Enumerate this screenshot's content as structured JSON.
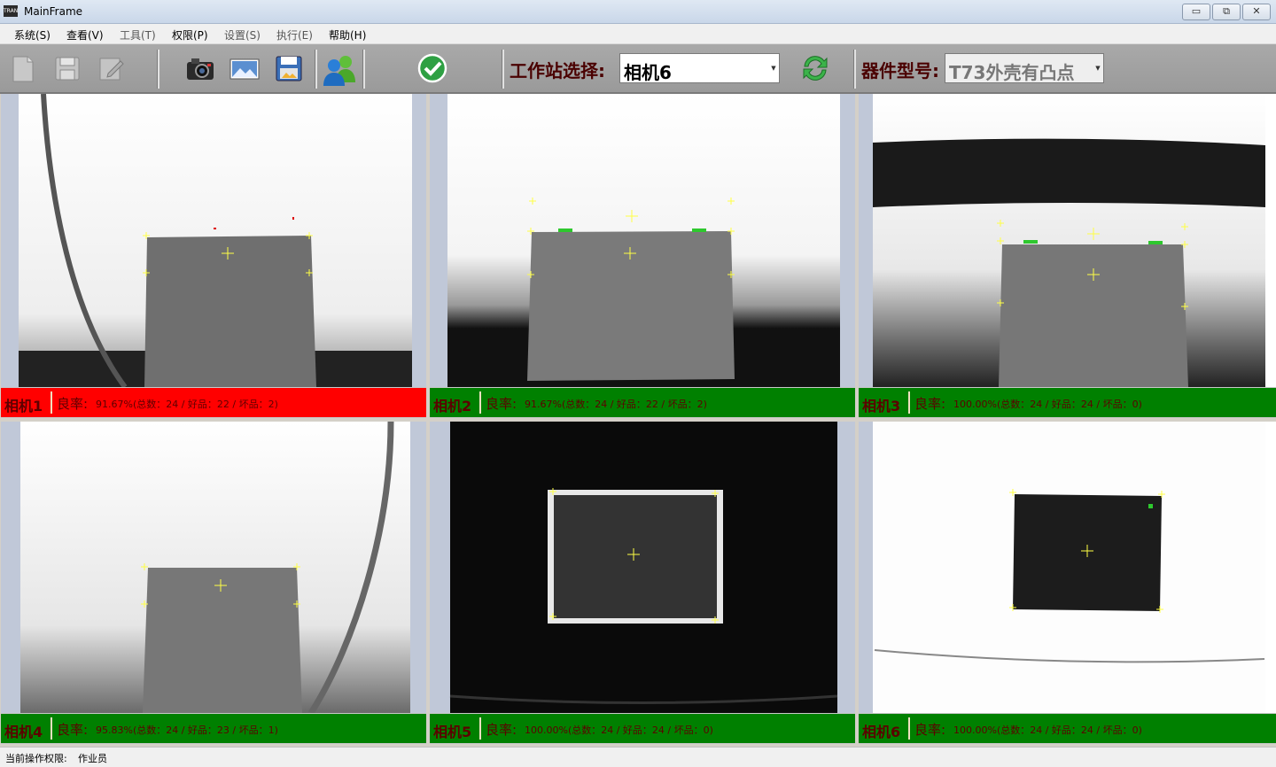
{
  "window": {
    "title": "MainFrame",
    "icon_text": "TRAN",
    "minimize": "▭",
    "restore": "⧉",
    "close": "✕"
  },
  "menu": [
    {
      "label": "系统(S)",
      "enabled": true
    },
    {
      "label": "查看(V)",
      "enabled": true
    },
    {
      "label": "工具(T)",
      "enabled": false
    },
    {
      "label": "权限(P)",
      "enabled": true
    },
    {
      "label": "设置(S)",
      "enabled": false
    },
    {
      "label": "执行(E)",
      "enabled": false
    },
    {
      "label": "帮助(H)",
      "enabled": true
    }
  ],
  "toolbar": {
    "icons": [
      "new-file-icon",
      "save-icon",
      "edit-icon",
      "camera-icon",
      "image-icon",
      "save-image-icon",
      "users-icon",
      "check-icon",
      "refresh-icon"
    ],
    "station_label": "工作站选择:",
    "station_value": "相机6",
    "model_label": "器件型号:",
    "model_value": "T73外壳有凸点"
  },
  "colors": {
    "fail": "#ff0000",
    "pass": "#008000",
    "label_text": "#5c0000"
  },
  "cameras": [
    {
      "name": "相机1",
      "rate_label": "良率:",
      "stats": "91.67%(总数：24 / 好品：22 / 坏品：2)",
      "status": "fail"
    },
    {
      "name": "相机2",
      "rate_label": "良率:",
      "stats": "91.67%(总数：24 / 好品：22 / 坏品：2)",
      "status": "pass"
    },
    {
      "name": "相机3",
      "rate_label": "良率:",
      "stats": "100.00%(总数：24 / 好品：24 / 坏品：0)",
      "status": "pass"
    },
    {
      "name": "相机4",
      "rate_label": "良率:",
      "stats": "95.83%(总数：24 / 好品：23 / 坏品：1)",
      "status": "pass"
    },
    {
      "name": "相机5",
      "rate_label": "良率:",
      "stats": "100.00%(总数：24 / 好品：24 / 坏品：0)",
      "status": "pass"
    },
    {
      "name": "相机6",
      "rate_label": "良率:",
      "stats": "100.00%(总数：24 / 好品：24 / 坏品：0)",
      "status": "pass"
    }
  ],
  "status": {
    "label": "当前操作权限:",
    "value": "作业员"
  }
}
